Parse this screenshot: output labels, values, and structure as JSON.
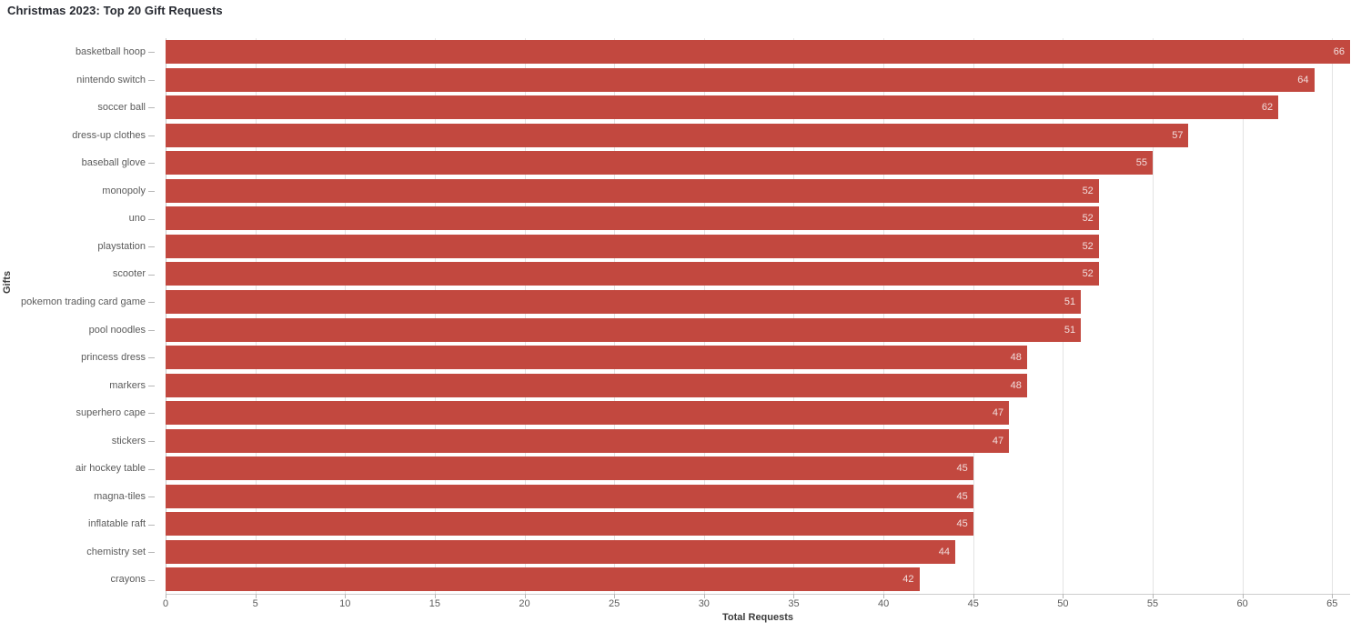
{
  "chart_data": {
    "type": "bar",
    "orientation": "horizontal",
    "title": "Christmas 2023: Top 20 Gift Requests",
    "xlabel": "Total Requests",
    "ylabel": "Gifts",
    "categories": [
      "basketball hoop",
      "nintendo switch",
      "soccer ball",
      "dress-up clothes",
      "baseball glove",
      "monopoly",
      "uno",
      "playstation",
      "scooter",
      "pokemon trading card game",
      "pool noodles",
      "princess dress",
      "markers",
      "superhero cape",
      "stickers",
      "air hockey table",
      "magna-tiles",
      "inflatable raft",
      "chemistry set",
      "crayons"
    ],
    "values": [
      66,
      64,
      62,
      57,
      55,
      52,
      52,
      52,
      52,
      51,
      51,
      48,
      48,
      47,
      47,
      45,
      45,
      45,
      44,
      42
    ],
    "value_labels": [
      "66",
      "64",
      "62",
      "57",
      "55",
      "52",
      "52",
      "52",
      "52",
      "51",
      "51",
      "48",
      "48",
      "47",
      "47",
      "45",
      "45",
      "45",
      "44",
      "42"
    ],
    "xticks": [
      0,
      5,
      10,
      15,
      20,
      25,
      30,
      35,
      40,
      45,
      50,
      55,
      60,
      65
    ],
    "xtick_labels": [
      "0",
      "5",
      "10",
      "15",
      "20",
      "25",
      "30",
      "35",
      "40",
      "45",
      "50",
      "55",
      "60",
      "65"
    ],
    "xlim": [
      0,
      66
    ],
    "grid": true,
    "legend": false,
    "bar_color": "#c2483f",
    "value_label_color": "#f1dedd",
    "tick_label_color": "#5b5b5b",
    "axis_title_color": "#3c3c3c",
    "title_color": "#262930",
    "gridline_color": "#e3e3e3",
    "background_color": "#ffffff"
  }
}
